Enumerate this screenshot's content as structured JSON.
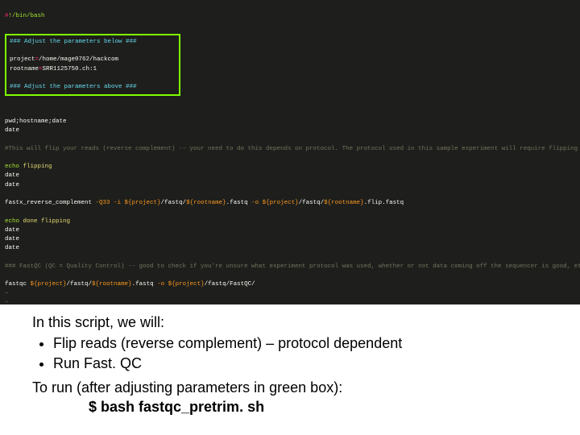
{
  "terminal": {
    "shebang": {
      "hash": "#",
      "path": "!/bin/bash"
    },
    "box": {
      "top": "### Adjust the parameters below ###",
      "l1a": "project",
      "l1b": "=",
      "l1c": "/home/mage0762/hackcom",
      "l2a": "rootname",
      "l2b": "=",
      "l2c": "SRR1125750.ch:1",
      "bot": "### Adjust the parameters above ###"
    },
    "pwd": "pwd;hostname;date",
    "date1": "date",
    "flipcomment": "#This will flip your reads (reverse complement) -- your need to do this depends on protocol. The protocol used in this sample experiment will require flipping",
    "echo1a": "echo",
    "echo1b": " flipping",
    "date2": "date",
    "date3": "date",
    "revcomp": {
      "a": "fastx_reverse_complement ",
      "b": "-Q33 -i ${project}",
      "c": "/fastq/",
      "d": "${rootname}",
      "e": ".fastq ",
      "f": "-o ${project}",
      "g": "/fastq/",
      "h": "${rootname}",
      "i": ".flip.fastq"
    },
    "echo2a": "echo",
    "echo2b": " done flipping",
    "date4": "date",
    "date5": "date",
    "date6": "date",
    "qccomment": "### FastQC (QC = Quality Control) -- good to check if you're unsure what experiment protocol was used, whether or not data coming off the sequencer is good, etc.",
    "fastqc": {
      "a": "fastqc ",
      "b": "${project}",
      "c": "/fastq/",
      "d": "${rootname}",
      "e": ".fastq ",
      "f": "-o ${project}",
      "g": "/fastq/FastQC/"
    },
    "tilde": "~"
  },
  "caption": {
    "intro": "In this script, we will:",
    "b1": "Flip reads (reverse complement) – protocol dependent",
    "b2": "Run Fast. QC",
    "run": "To run (after adjusting parameters in green box):",
    "cmd": "$ bash fastqc_pretrim. sh"
  }
}
